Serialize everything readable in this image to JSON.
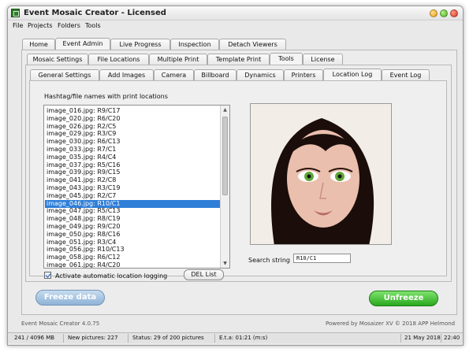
{
  "window": {
    "title": "Event Mosaic Creator - Licensed"
  },
  "menu": [
    "File",
    "Projects",
    "Folders",
    "Tools"
  ],
  "main_tabs": [
    "Home",
    "Event Admin",
    "Live Progress",
    "Inspection",
    "Detach Viewers"
  ],
  "sub_tabs": [
    "Mosaic Settings",
    "File Locations",
    "Multiple Print",
    "Template Print",
    "Tools",
    "License"
  ],
  "inner_tabs": [
    "General Settings",
    "Add Images",
    "Camera",
    "Billboard",
    "Dynamics",
    "Printers",
    "Location Log",
    "Event Log"
  ],
  "location_log": {
    "list_label": "Hashtag/file names with print locations",
    "items": [
      "image_016.jpg: R9/C17",
      "image_020.jpg: R6/C20",
      "image_026.jpg: R2/C5",
      "image_029.jpg: R3/C9",
      "image_030.jpg: R6/C13",
      "image_033.jpg: R7/C1",
      "image_035.jpg: R4/C4",
      "image_037.jpg: R5/C16",
      "image_039.jpg: R9/C15",
      "image_041.jpg: R2/C8",
      "image_043.jpg: R3/C19",
      "image_045.jpg: R2/C7",
      "image_046.jpg: R10/C1",
      "image_047.jpg: R5/C13",
      "image_048.jpg: R8/C19",
      "image_049.jpg: R9/C20",
      "image_050.jpg: R8/C16",
      "image_051.jpg: R3/C4",
      "image_056.jpg: R10/C13",
      "image_058.jpg: R6/C12",
      "image_061.jpg: R4/C20"
    ],
    "selected_index": 12,
    "checkbox_label": "Activate automatic location logging",
    "checkbox_checked": true,
    "del_button": "DEL List",
    "search_label": "Search string",
    "search_value": "R10/C1"
  },
  "actions": {
    "freeze": "Freeze data",
    "unfreeze": "Unfreeze"
  },
  "footer": {
    "version": "Event Mosaic Creator 4.0.75",
    "powered": "Powered by Mosaizer XV © 2018  APP Helmond"
  },
  "status": {
    "memory": "241 / 4096 MB",
    "new_pictures": "New pictures: 227",
    "status": "Status: 29 of 200 pictures",
    "eta": "E.t.a: 01:21 (m:s)",
    "date": "21 May 2018",
    "time": "22:40"
  },
  "colors": {
    "selection": "#2f7fd8",
    "unfreeze": "#2aa71d",
    "freeze": "#8fb2d6"
  }
}
